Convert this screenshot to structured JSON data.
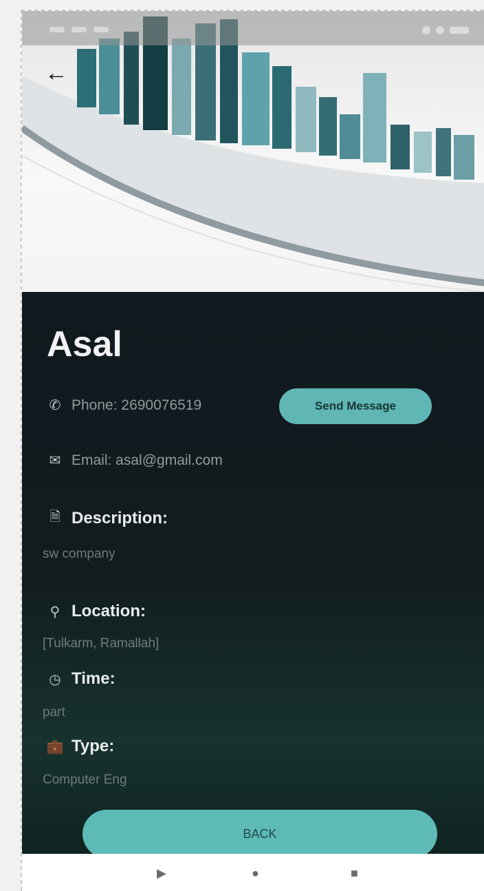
{
  "profile": {
    "name": "Asal",
    "phone": "Phone: 2690076519",
    "email": "Email: asal@gmail.com",
    "description_label": "Description:",
    "description_value": "sw company",
    "location_label": "Location:",
    "location_value": "[Tulkarm, Ramallah]",
    "time_label": "Time:",
    "time_value": "part",
    "type_label": "Type:",
    "type_value": "Computer Eng"
  },
  "actions": {
    "send_message": "Send Message",
    "back": "BACK"
  },
  "icons": {
    "back": "arrow-left-icon",
    "phone": "phone-icon",
    "email": "email-icon",
    "description": "document-icon",
    "location": "location-pin-icon",
    "time": "clock-icon",
    "type": "briefcase-icon",
    "nav_back": "triangle-back-icon",
    "nav_home": "circle-home-icon",
    "nav_recents": "square-recents-icon"
  },
  "colors": {
    "accent": "#5ebab6",
    "panel_bg": "#121c1f",
    "text_primary": "#f2f2f2",
    "text_secondary": "#8f9b9c"
  }
}
